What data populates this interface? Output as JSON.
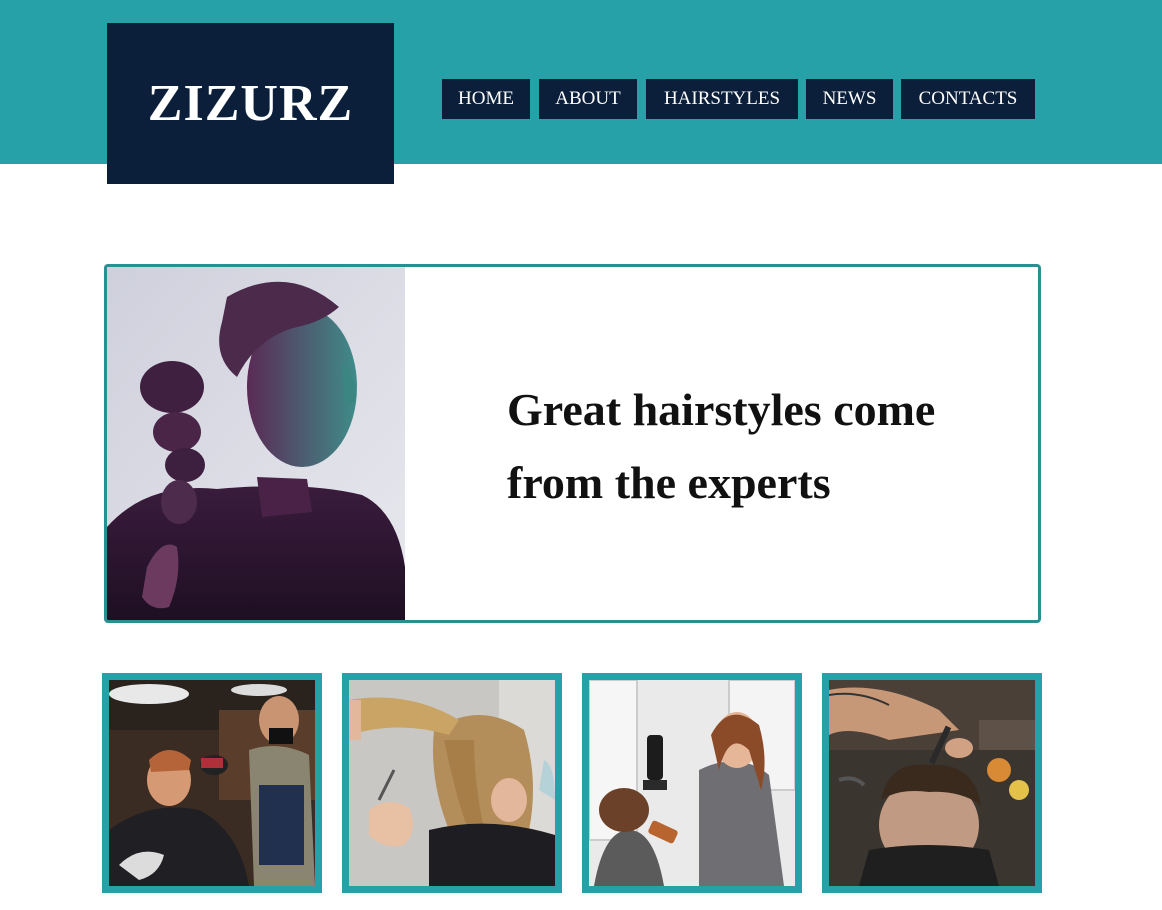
{
  "brand": {
    "name": "ZIZURZ"
  },
  "nav": {
    "items": [
      {
        "label": "HOME"
      },
      {
        "label": "ABOUT"
      },
      {
        "label": "HAIRSTYLES"
      },
      {
        "label": "NEWS"
      },
      {
        "label": "CONTACTS"
      }
    ]
  },
  "hero": {
    "heading": "Great hairstyles come from the experts"
  },
  "colors": {
    "accent": "#26a1a8",
    "navy": "#0b1f3a",
    "hero_border": "#2a8f93"
  },
  "gallery": [
    {
      "icon": "barber-cut-photo"
    },
    {
      "icon": "hair-trim-photo"
    },
    {
      "icon": "blow-dry-photo"
    },
    {
      "icon": "fade-cut-photo"
    }
  ]
}
